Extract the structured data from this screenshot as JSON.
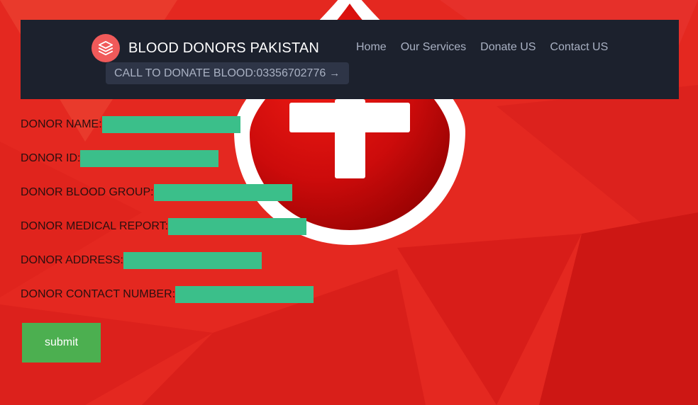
{
  "header": {
    "brand": "BLOOD DONORS PAKISTAN",
    "logo_icon": "layers-icon",
    "nav": [
      "Home",
      "Our Services",
      "Donate US",
      "Contact US"
    ],
    "cta_label": "CALL TO DONATE BLOOD:03356702776",
    "cta_arrow": "→"
  },
  "form": {
    "fields": [
      {
        "label": "DONOR NAME:",
        "value": ""
      },
      {
        "label": "DONOR ID:",
        "value": ""
      },
      {
        "label": "DONOR BLOOD GROUP:",
        "value": ""
      },
      {
        "label": "DONOR MEDICAL REPORT:",
        "value": ""
      },
      {
        "label": "DONOR ADDRESS:",
        "value": ""
      },
      {
        "label": "DONOR CONTACT NUMBER:",
        "value": ""
      }
    ],
    "submit_label": "submit"
  },
  "colors": {
    "background": "#e32621",
    "header": "#1c212d",
    "input": "#3bbf8a",
    "submit": "#4caf50",
    "logo": "#f05a5a"
  }
}
